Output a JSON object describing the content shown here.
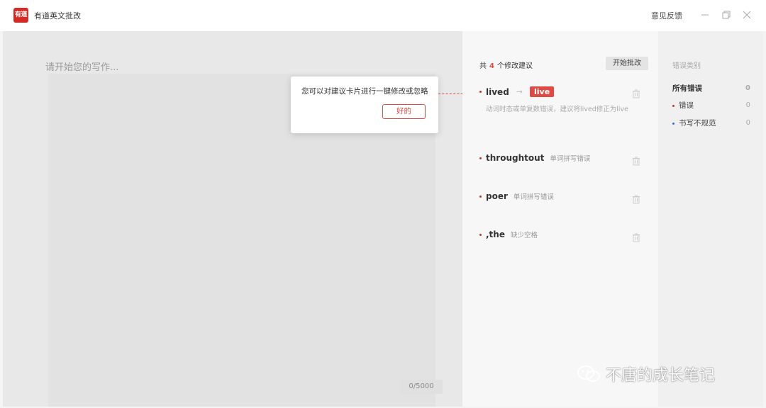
{
  "titlebar": {
    "logo_text": "有道",
    "app_title": "有道英文批改",
    "feedback": "意见反馈",
    "icons": [
      "minimize-icon",
      "maximize-icon",
      "close-icon"
    ]
  },
  "editor": {
    "placeholder": "请开始您的写作...",
    "counter": "0/5000"
  },
  "tooltip": {
    "text": "您可以对建议卡片进行一键修改或忽略",
    "button": "好的"
  },
  "suggestions": {
    "header_prefix": "共",
    "count": "4",
    "header_suffix": "个修改建议",
    "start_button": "开始批改",
    "items": [
      {
        "word": "lived",
        "fix": "live",
        "desc": "动词时态或单复数错误，建议将lived修正为live"
      },
      {
        "word": "throughtout",
        "desc": "单词拼写错误"
      },
      {
        "word": "poer",
        "desc": "单词拼写错误"
      },
      {
        "word": ",the",
        "desc": "缺少空格"
      }
    ]
  },
  "categories": {
    "title": "错误类别",
    "items": [
      {
        "label": "所有错误",
        "count": "0",
        "color": ""
      },
      {
        "label": "错误",
        "count": "0",
        "color": "#c0392b"
      },
      {
        "label": "书写不规范",
        "count": "0",
        "color": "#3b6fd6"
      }
    ]
  },
  "watermark": {
    "text": "不唐的成长笔记"
  },
  "colors": {
    "brand": "#d22a25",
    "accent": "#e04a45",
    "info": "#3b6fd6"
  }
}
